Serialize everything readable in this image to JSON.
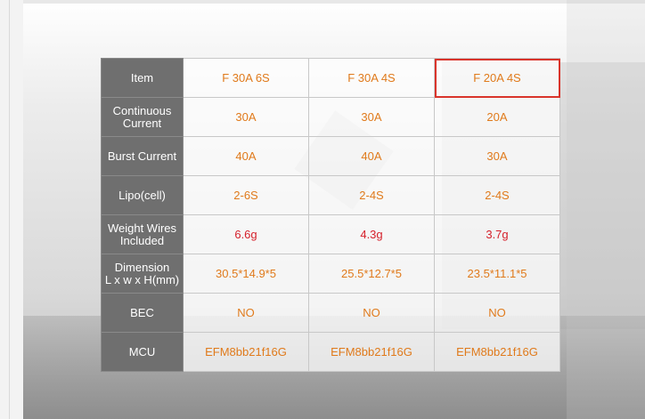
{
  "table": {
    "header": {
      "item": "Item",
      "models": [
        "F 30A 6S",
        "F 30A 4S",
        "F 20A 4S"
      ]
    },
    "rows": [
      {
        "label_line1": "Continuous",
        "label_line2": "Current",
        "values": [
          "30A",
          "30A",
          "20A"
        ]
      },
      {
        "label_line1": "Burst Current",
        "label_line2": "",
        "values": [
          "40A",
          "40A",
          "30A"
        ]
      },
      {
        "label_line1": "Lipo(cell)",
        "label_line2": "",
        "values": [
          "2-6S",
          "2-4S",
          "2-4S"
        ]
      },
      {
        "label_line1": "Weight Wires",
        "label_line2": "Included",
        "values": [
          "6.6g",
          "4.3g",
          "3.7g"
        ]
      },
      {
        "label_line1": "Dimension",
        "label_line2": "L x w x H(mm)",
        "values": [
          "30.5*14.9*5",
          "25.5*12.7*5",
          "23.5*11.1*5"
        ]
      },
      {
        "label_line1": "BEC",
        "label_line2": "",
        "values": [
          "NO",
          "NO",
          "NO"
        ]
      },
      {
        "label_line1": "MCU",
        "label_line2": "",
        "values": [
          "EFM8bb21f16G",
          "EFM8bb21f16G",
          "EFM8bb21f16G"
        ]
      }
    ]
  },
  "colors": {
    "label_bg": "#6f6f6f",
    "value_text": "#e07a1b",
    "weight_text": "#d5202b",
    "highlight_border": "#d9342b"
  }
}
